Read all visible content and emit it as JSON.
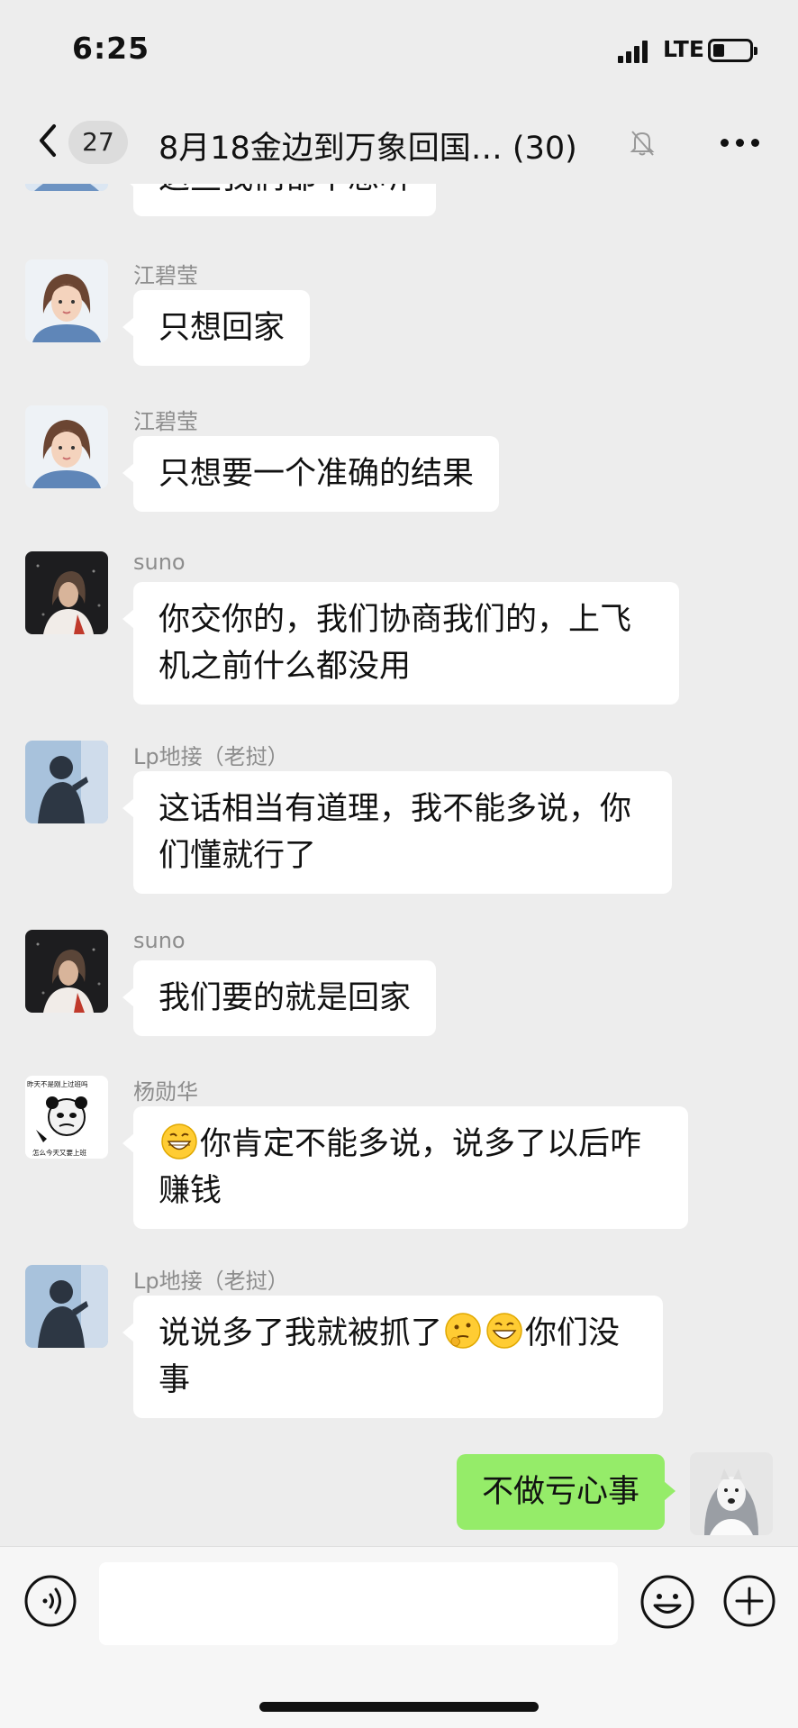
{
  "status_bar": {
    "time": "6:25",
    "network": "LTE",
    "battery_level": 0.25
  },
  "nav": {
    "back_icon": "chevron-left-icon",
    "unread_count": "27",
    "title": "8月18金边到万象回国… (30)",
    "mute_icon": "bell-muted-icon",
    "more_icon": "more-dots-icon"
  },
  "messages": [
    {
      "sender": "",
      "text": "这些我们都不想听",
      "partial": true
    },
    {
      "sender": "江碧莹",
      "text": "只想回家"
    },
    {
      "sender": "江碧莹",
      "text": "只想要一个准确的结果"
    },
    {
      "sender": "suno",
      "text": "你交你的，我们协商我们的，上飞机之前什么都没用"
    },
    {
      "sender": "Lp地接（老挝）",
      "text": "这话相当有道理，我不能多说，你们懂就行了"
    },
    {
      "sender": "suno",
      "text": "我们要的就是回家"
    },
    {
      "sender": "杨勋华",
      "text_before_emoji": "",
      "text": "你肯定不能多说，说多了以后咋赚钱",
      "emoji": "grinning-face-icon"
    },
    {
      "sender": "Lp地接（老挝）",
      "text": "说说多了我就被抓了",
      "text_after": "你们没事",
      "emojis": [
        "thinking-face-icon",
        "grinning-face-icon"
      ]
    },
    {
      "sender": "me",
      "text": "不做亏心事"
    }
  ],
  "meme_avatar_text": {
    "top": "昨天不是刚上过班吗",
    "bottom": "怎么今天又要上班"
  },
  "input_bar": {
    "voice_icon": "voice-icon",
    "placeholder": "",
    "emoji_icon": "smiley-icon",
    "plus_icon": "plus-circle-icon"
  },
  "colors": {
    "background": "#ededed",
    "bubble_other": "#ffffff",
    "bubble_mine": "#95ec69",
    "sender_name": "#8d8d8d"
  }
}
